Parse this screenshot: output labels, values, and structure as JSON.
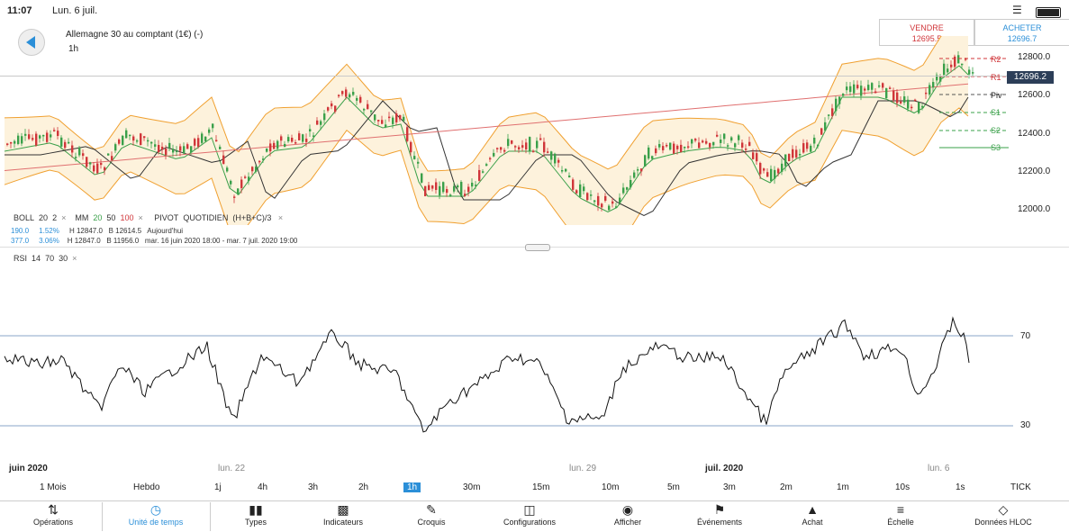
{
  "status_bar": {
    "time": "11:07",
    "date": "Lun. 6 juil."
  },
  "header": {
    "instrument": "Allemagne 30 au comptant (1€) (-)",
    "timeframe": "1h",
    "sell": {
      "label": "VENDRE",
      "price": "12695.5"
    },
    "buy": {
      "label": "ACHETER",
      "price": "12696.7"
    }
  },
  "price_axis": [
    "12800.0",
    "12600.0",
    "12400.0",
    "12200.0",
    "12000.0"
  ],
  "current_price": "12696.2",
  "pivot_labels": [
    "R2",
    "R1",
    "Piv",
    "S1",
    "S2",
    "S3"
  ],
  "indicators": {
    "boll": {
      "name": "BOLL",
      "p1": "20",
      "p2": "2",
      "close": "×"
    },
    "mm": {
      "name": "MM",
      "p1": "20",
      "p2": "50",
      "p3": "100",
      "close": "×"
    },
    "pivot": {
      "name": "PIVOT",
      "period": "QUOTIDIEN",
      "formula": "(H+B+C)/3",
      "close": "×"
    }
  },
  "info": {
    "row1": {
      "a": "190.0",
      "b": "1.52%",
      "h": "H 12847.0",
      "l": "B 12614.5",
      "range": "Aujourd'hui"
    },
    "row2": {
      "a": "377.0",
      "b": "3.06%",
      "h": "H 12847.0",
      "l": "B 11956.0",
      "range": "mar. 16 juin 2020 18:00 - mar. 7 juil. 2020 19:00"
    }
  },
  "rsi": {
    "name": "RSI",
    "p1": "14",
    "p2": "70",
    "p3": "30",
    "close": "×",
    "upper": "70",
    "lower": "30"
  },
  "dates": [
    {
      "label": "juin 2020",
      "bold": true
    },
    {
      "label": "lun. 22",
      "bold": false
    },
    {
      "label": "lun. 29",
      "bold": false
    },
    {
      "label": "juil. 2020",
      "bold": true
    },
    {
      "label": "lun. 6",
      "bold": false
    }
  ],
  "timeframes": [
    "1 Mois",
    "Hebdo",
    "1j",
    "4h",
    "3h",
    "2h",
    "1h",
    "30m",
    "15m",
    "10m",
    "5m",
    "3m",
    "2m",
    "1m",
    "10s",
    "1s",
    "TICK"
  ],
  "active_timeframe": "1h",
  "toolbar": [
    {
      "label": "Opérations",
      "icon": "up-down-arrows-icon"
    },
    {
      "label": "Unité de temps",
      "icon": "clock-icon"
    },
    {
      "label": "Types",
      "icon": "candles-icon"
    },
    {
      "label": "Indicateurs",
      "icon": "bar-chart-icon"
    },
    {
      "label": "Croquis",
      "icon": "pencil-icon"
    },
    {
      "label": "Configurations",
      "icon": "layout-icon"
    },
    {
      "label": "Afficher",
      "icon": "eye-icon"
    },
    {
      "label": "Événements",
      "icon": "flag-icon"
    },
    {
      "label": "Achat",
      "icon": "bell-icon"
    },
    {
      "label": "Échelle",
      "icon": "scale-icon"
    },
    {
      "label": "Données HLOC",
      "icon": "diamond-icon"
    }
  ],
  "colors": {
    "up": "#3aa04a",
    "down": "#d0363a",
    "boll": "#f0a030",
    "accent": "#2b8fd8",
    "rsi_line": "#111111"
  }
}
